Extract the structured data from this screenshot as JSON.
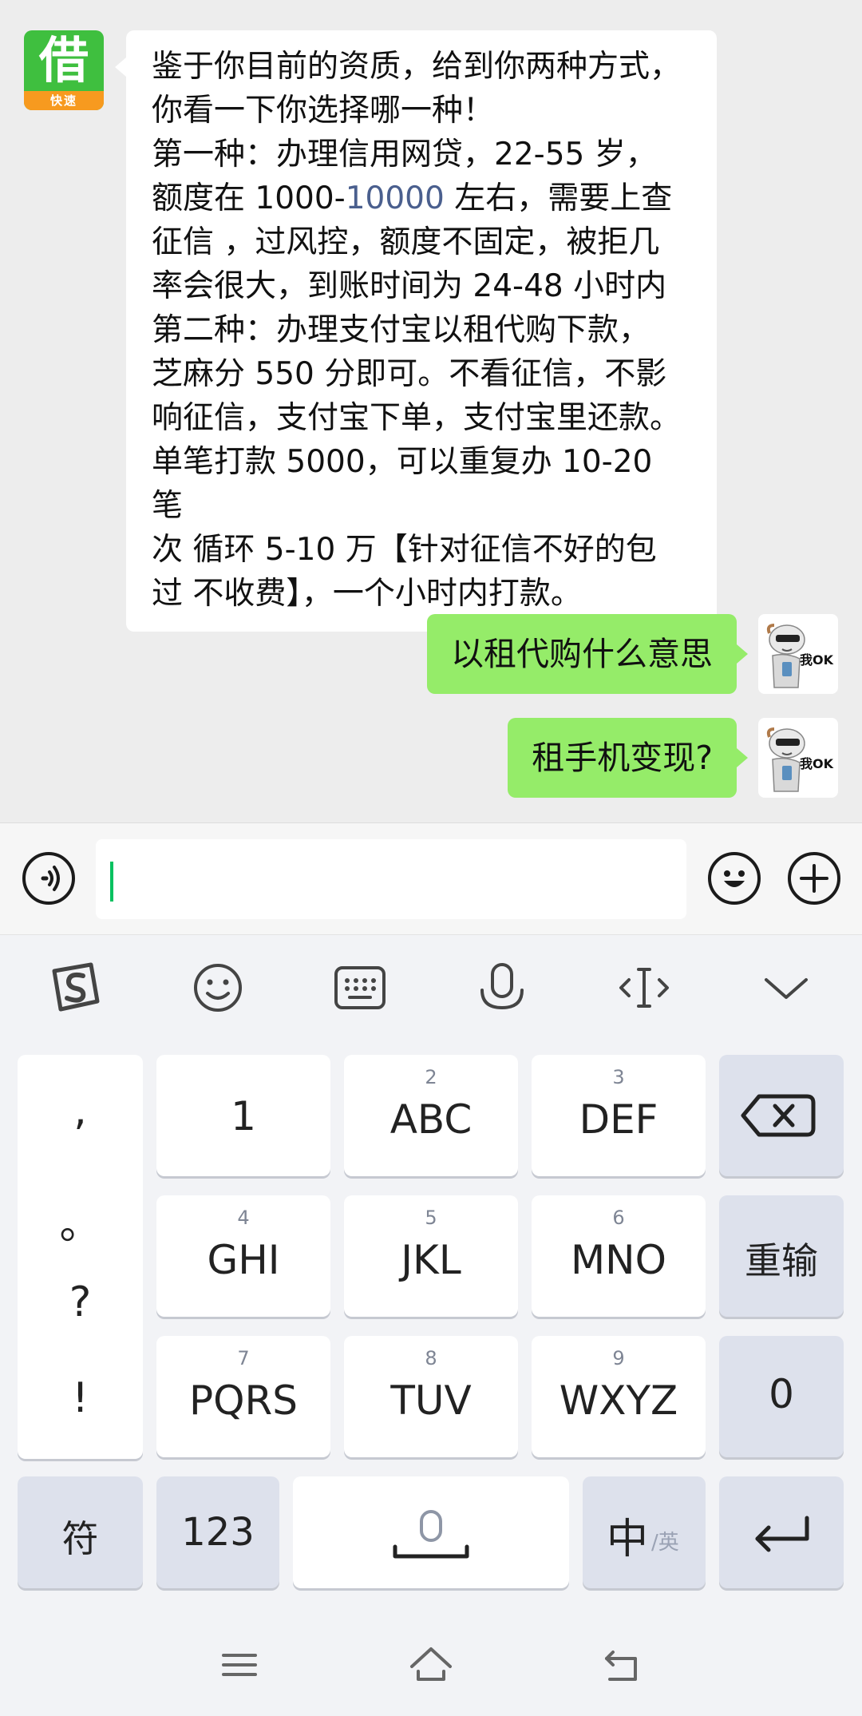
{
  "chat": {
    "incoming_avatar": {
      "glyph": "借",
      "label": "快速",
      "bg_color": "#3fbf3f",
      "band_color": "#f79a1f"
    },
    "incoming_message": {
      "line1": "鉴于你目前的资质，给到你两种方式，",
      "line2": "你看一下你选择哪一种！",
      "line3": "第一种：办理信用网贷，22-55 岁，",
      "line4_a": "额度在 1000-",
      "line4_link": "10000",
      "line4_b": " 左右，需要上查",
      "line5": "征信 ，过风控，额度不固定，被拒几",
      "line6": "率会很大，到账时间为 24-48 小时内",
      "line7": "第二种：办理支付宝以租代购下款，",
      "line8": "芝麻分 550 分即可。不看征信，不影",
      "line9": "响征信，支付宝下单，支付宝里还款。",
      "line10": "单笔打款 5000，可以重复办 10-20 笔",
      "line11": "次 循环 5-10 万【针对征信不好的包",
      "line12": "过 不收费】，一个小时内打款。"
    },
    "outgoing_messages": [
      {
        "text": "以租代购什么意思"
      },
      {
        "text": "租手机变现?"
      }
    ],
    "outgoing_avatar_caption": "我OK",
    "bubble_out_color": "#95ec69"
  },
  "input_bar": {
    "voice_icon": "voice-icon",
    "emoji_icon": "emoji-icon",
    "plus_icon": "plus-icon",
    "placeholder": ""
  },
  "keyboard_toolbar": [
    "sogou-logo-icon",
    "emoji-face-icon",
    "keyboard-icon",
    "microphone-icon",
    "cursor-move-icon",
    "chevron-down-icon"
  ],
  "keyboard": {
    "punctuation": [
      ",",
      "。",
      "?",
      "!"
    ],
    "row1": [
      {
        "sub": "",
        "main": "1"
      },
      {
        "sub": "2",
        "main": "ABC"
      },
      {
        "sub": "3",
        "main": "DEF"
      }
    ],
    "row2": [
      {
        "sub": "4",
        "main": "GHI"
      },
      {
        "sub": "5",
        "main": "JKL"
      },
      {
        "sub": "6",
        "main": "MNO"
      }
    ],
    "row3": [
      {
        "sub": "7",
        "main": "PQRS"
      },
      {
        "sub": "8",
        "main": "TUV"
      },
      {
        "sub": "9",
        "main": "WXYZ"
      }
    ],
    "retype_label": "重输",
    "zero_label": "0",
    "symbol_label": "符",
    "num_label": "123",
    "lang_main": "中",
    "lang_sub": "/英"
  },
  "nav_bar": [
    "menu-icon",
    "home-icon",
    "back-icon"
  ]
}
